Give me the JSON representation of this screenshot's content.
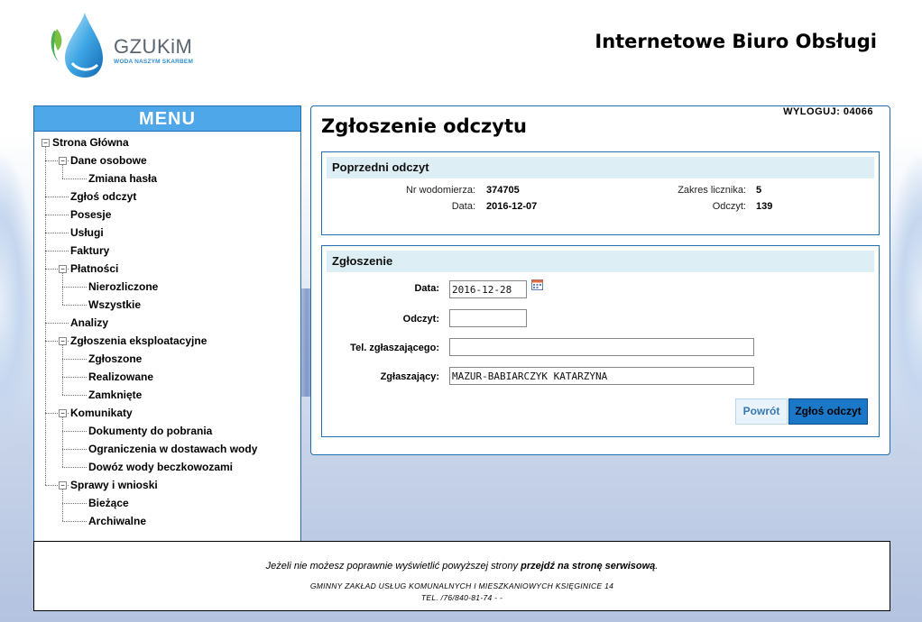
{
  "header": {
    "logo_name": "GZUKiM",
    "logo_tagline": "WODA NASZYM SKARBEM",
    "site_title": "Internetowe Biuro Obsługi"
  },
  "menu": {
    "title": "MENU",
    "items": [
      {
        "label": "Strona Główna",
        "level": 0,
        "expanded": true
      },
      {
        "label": "Dane osobowe",
        "level": 1,
        "expanded": true
      },
      {
        "label": "Zmiana hasła",
        "level": 2
      },
      {
        "label": "Zgłoś odczyt",
        "level": 1
      },
      {
        "label": "Posesje",
        "level": 1
      },
      {
        "label": "Usługi",
        "level": 1
      },
      {
        "label": "Faktury",
        "level": 1
      },
      {
        "label": "Płatności",
        "level": 1,
        "expanded": true
      },
      {
        "label": "Nierozliczone",
        "level": 2
      },
      {
        "label": "Wszystkie",
        "level": 2
      },
      {
        "label": "Analizy",
        "level": 1
      },
      {
        "label": "Zgłoszenia eksploatacyjne",
        "level": 1,
        "expanded": true
      },
      {
        "label": "Zgłoszone",
        "level": 2
      },
      {
        "label": "Realizowane",
        "level": 2
      },
      {
        "label": "Zamknięte",
        "level": 2
      },
      {
        "label": "Komunikaty",
        "level": 1,
        "expanded": true
      },
      {
        "label": "Dokumenty do pobrania",
        "level": 2
      },
      {
        "label": "Ograniczenia w dostawach wody",
        "level": 2
      },
      {
        "label": "Dowóz wody beczkowozami",
        "level": 2
      },
      {
        "label": "Sprawy i wnioski",
        "level": 1,
        "expanded": true
      },
      {
        "label": "Bieżące",
        "level": 2
      },
      {
        "label": "Archiwalne",
        "level": 2
      }
    ]
  },
  "content": {
    "logout_label": "WYLOGUJ: 04066",
    "page_title": "Zgłoszenie odczytu",
    "previous": {
      "title": "Poprzedni odczyt",
      "meter_label": "Nr wodomierza:",
      "meter_value": "374705",
      "date_label": "Data:",
      "date_value": "2016-12-07",
      "range_label": "Zakres licznika:",
      "range_value": "5",
      "reading_label": "Odczyt:",
      "reading_value": "139"
    },
    "form": {
      "title": "Zgłoszenie",
      "date_label": "Data:",
      "date_value": "2016-12-28",
      "reading_label": "Odczyt:",
      "reading_value": "",
      "phone_label": "Tel. zgłaszającego:",
      "phone_value": "",
      "reporter_label": "Zgłaszający:",
      "reporter_value": "MAZUR-BABIARCZYK KATARZYNA",
      "back_label": "Powrót",
      "submit_label": "Zgłoś odczyt"
    }
  },
  "footer": {
    "line1_text": "Jeżeli nie możesz poprawnie wyświetlić powyższej strony ",
    "line1_link": "przejdź na stronę serwisową",
    "line1_end": ".",
    "line2": "GMINNY ZAKŁAD USŁUG KOMUNALNYCH I MIESZKANIOWYCH KSIĘGINICE 14",
    "line3": "TEL. /76/840-81-74 - -"
  },
  "colors": {
    "accent": "#4da7e8",
    "border": "#1f6fb3",
    "section_header": "#ddeef4",
    "submit_button": "#1b78c9"
  }
}
